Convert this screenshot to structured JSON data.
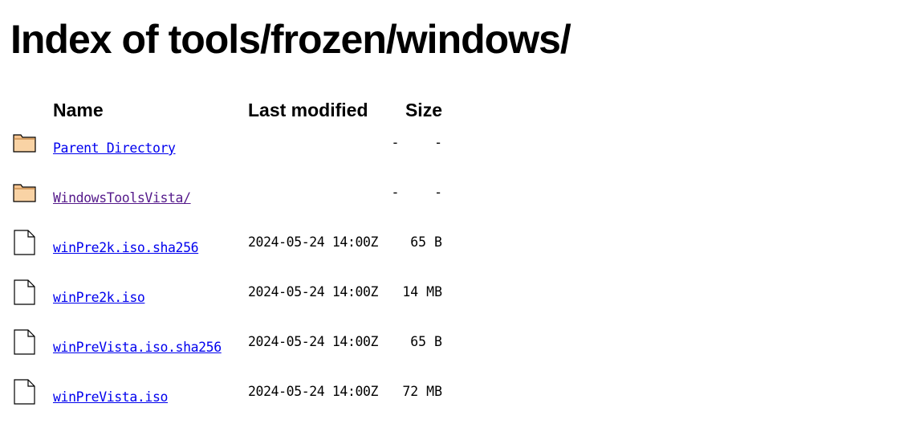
{
  "page": {
    "title": "Index of tools/frozen/windows/"
  },
  "table": {
    "headers": {
      "name": "Name",
      "last_modified": "Last modified",
      "size": "Size"
    },
    "rows": [
      {
        "icon": "folder-icon",
        "name": "Parent Directory",
        "last_modified": "",
        "size": "-",
        "date_dash": "-",
        "visited": false
      },
      {
        "icon": "folder-icon",
        "name": "WindowsToolsVista/",
        "last_modified": "",
        "size": "-",
        "date_dash": "-",
        "visited": true
      },
      {
        "icon": "file-icon",
        "name": "winPre2k.iso.sha256",
        "last_modified": "2024-05-24 14:00Z",
        "size": "65 B",
        "visited": false
      },
      {
        "icon": "file-icon",
        "name": "winPre2k.iso",
        "last_modified": "2024-05-24 14:00Z",
        "size": "14 MB",
        "visited": false
      },
      {
        "icon": "file-icon",
        "name": "winPreVista.iso.sha256",
        "last_modified": "2024-05-24 14:00Z",
        "size": "65 B",
        "visited": false
      },
      {
        "icon": "file-icon",
        "name": "winPreVista.iso",
        "last_modified": "2024-05-24 14:00Z",
        "size": "72 MB",
        "visited": false
      }
    ]
  },
  "colors": {
    "link": "#0000ee",
    "visited_link": "#551a8b",
    "folder_fill": "#f7c48f",
    "folder_stroke": "#000000"
  }
}
